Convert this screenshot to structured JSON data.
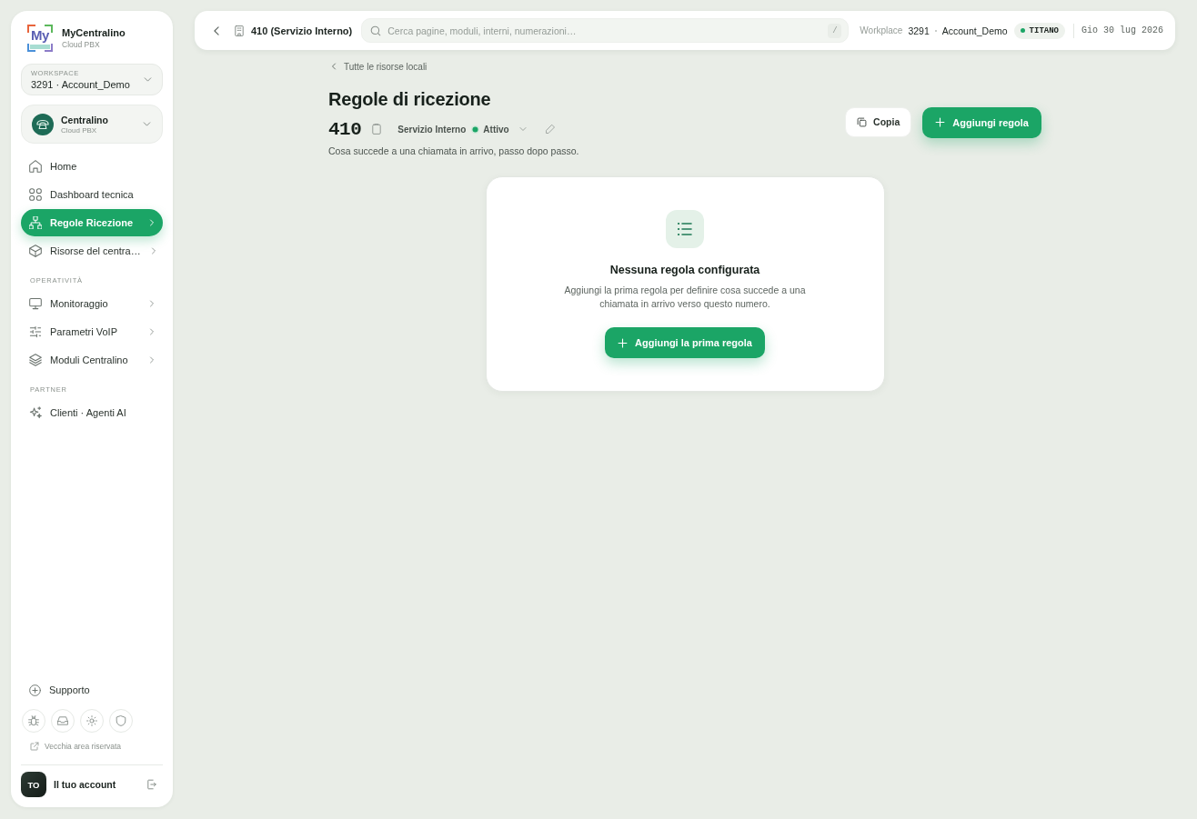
{
  "sidebar": {
    "brand": {
      "logo_text": "My",
      "name": "MyCentralino",
      "subtitle": "Cloud PBX"
    },
    "workspace": {
      "label": "WORKSPACE",
      "value": "3291 · Account_Demo"
    },
    "switcher": {
      "name": "Centralino",
      "subtitle": "Cloud PBX"
    },
    "sections": [
      {
        "items": [
          {
            "label": "Home",
            "selected": false,
            "expandable": false
          },
          {
            "label": "Dashboard tecnica",
            "selected": false,
            "expandable": false
          },
          {
            "label": "Regole Ricezione",
            "selected": true,
            "expandable": true
          },
          {
            "label": "Risorse del centra…",
            "selected": false,
            "expandable": true
          }
        ]
      },
      {
        "heading": "OPERATIVITÀ",
        "items": [
          {
            "label": "Monitoraggio",
            "selected": false,
            "expandable": true
          },
          {
            "label": "Parametri VoIP",
            "selected": false,
            "expandable": true
          },
          {
            "label": "Moduli Centralino",
            "selected": false,
            "expandable": true
          }
        ]
      },
      {
        "heading": "PARTNER",
        "items": [
          {
            "label": "Clienti · Agenti AI",
            "selected": false,
            "expandable": false
          }
        ]
      }
    ],
    "support": "Supporto",
    "legacy_link": "Vecchia area riservata",
    "account": {
      "initials": "TO",
      "label": "Il tuo account"
    }
  },
  "topbar": {
    "title": "410 (Servizio Interno)",
    "search": {
      "placeholder": "Cerca pagine, moduli, interni, numerazioni…",
      "shortcut": "/"
    },
    "workplace": {
      "label": "Workplace",
      "id": "3291",
      "account": "Account_Demo"
    },
    "plan": "TITANO",
    "date": "Gio 30 lug 2026"
  },
  "page": {
    "back_link": "Tutte le risorse locali",
    "title": "Regole di ricezione",
    "number": "410",
    "type": "Servizio Interno",
    "status": "Attivo",
    "description": "Cosa succede a una chiamata in arrivo, passo dopo passo.",
    "actions": [
      {
        "kind": "secondary",
        "label": "Copia"
      },
      {
        "kind": "primary",
        "label": "Aggiungi regola"
      }
    ]
  },
  "empty_state": {
    "title": "Nessuna regola configurata",
    "text": "Aggiungi la prima regola per definire cosa succede a una chiamata in arrivo verso questo numero.",
    "button": "Aggiungi la prima regola"
  }
}
